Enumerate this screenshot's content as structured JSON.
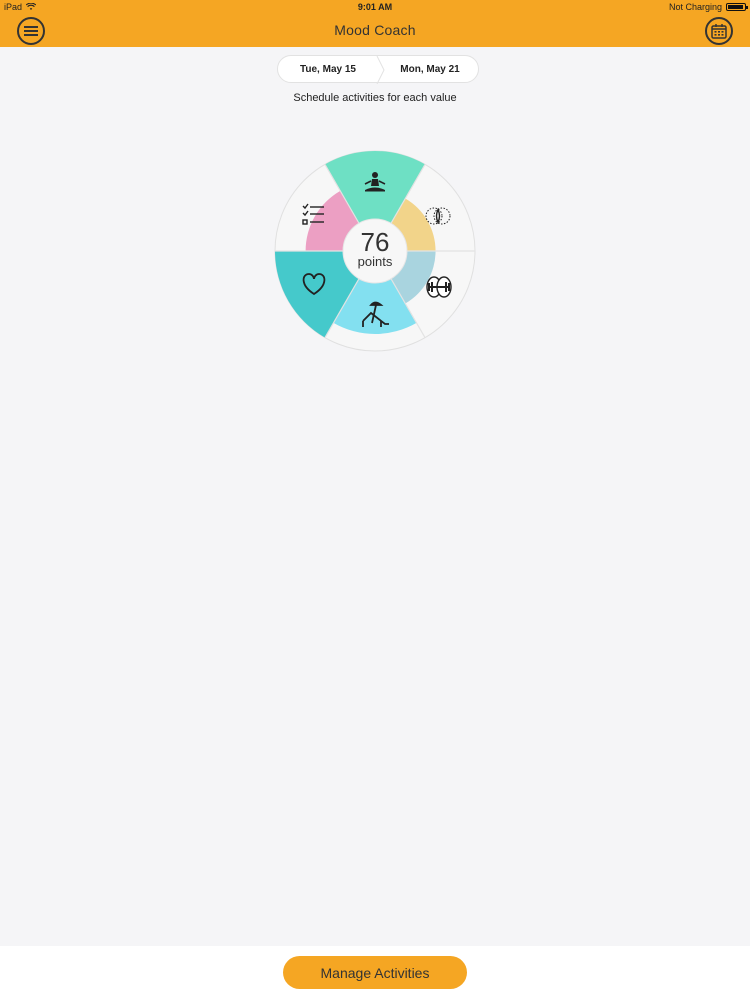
{
  "status_bar": {
    "carrier": "iPad",
    "time": "9:01 AM",
    "battery_text": "Not Charging"
  },
  "header": {
    "title": "Mood Coach",
    "menu_icon": "menu-icon",
    "calendar_icon": "calendar-icon"
  },
  "date_range": {
    "start": "Tue, May 15",
    "end": "Mon, May 21"
  },
  "subtitle": "Schedule activities for each value",
  "wheel": {
    "points_value": "76",
    "points_label": "points",
    "segments": [
      {
        "icon": "meditation-icon",
        "color": "#6ee0c4",
        "level": 1.0
      },
      {
        "icon": "relationship-icon",
        "color": "#f2d48a",
        "level": 0.42
      },
      {
        "icon": "fitness-icon",
        "color": "#a9d4df",
        "level": 0.42
      },
      {
        "icon": "leisure-icon",
        "color": "#83e0f0",
        "level": 0.75
      },
      {
        "icon": "heart-icon",
        "color": "#45c9cb",
        "level": 1.0
      },
      {
        "icon": "tasks-icon",
        "color": "#ec9fc3",
        "level": 0.55
      }
    ]
  },
  "footer": {
    "manage_label": "Manage Activities"
  },
  "colors": {
    "accent": "#f5a623",
    "background": "#f5f5f7"
  }
}
